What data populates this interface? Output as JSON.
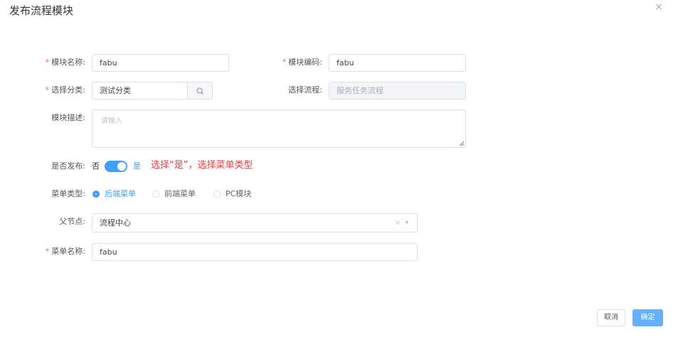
{
  "dialog": {
    "title": "发布流程模块",
    "close_glyph": "×"
  },
  "form": {
    "module_name": {
      "required_mark": "*",
      "label": "模块名称:",
      "value": "fabu"
    },
    "module_code": {
      "required_mark": "*",
      "label": "模块编码:",
      "value": "fabu"
    },
    "category": {
      "required_mark": "*",
      "label": "选择分类:",
      "value": "测试分类",
      "addon_icon": "search-icon"
    },
    "process": {
      "label": "选择流程:",
      "value": "服务任务流程"
    },
    "description": {
      "label": "模块描述:",
      "placeholder": "请输入"
    },
    "publish": {
      "label": "是否发布:",
      "off_text": "否",
      "on_text": "是",
      "checked": true,
      "hint": "选择“是”，选择菜单类型"
    },
    "menu_type": {
      "label": "菜单类型:",
      "options": [
        {
          "label": "后端菜单",
          "checked": true
        },
        {
          "label": "前端菜单",
          "checked": false
        },
        {
          "label": "PC模块",
          "checked": false
        }
      ]
    },
    "parent_node": {
      "label": "父节点:",
      "value": "流程中心",
      "clear_glyph": "×",
      "arrow_glyph": "▾"
    },
    "menu_name": {
      "required_mark": "*",
      "label": "菜单名称:",
      "value": "fabu"
    }
  },
  "footer": {
    "cancel_label": "取消",
    "ok_label": "确定"
  },
  "colors": {
    "primary": "#409eff",
    "primary_light": "#66b1ff",
    "required": "#f56c6c",
    "hint": "#f23c3c",
    "border": "#dcdfe6"
  }
}
